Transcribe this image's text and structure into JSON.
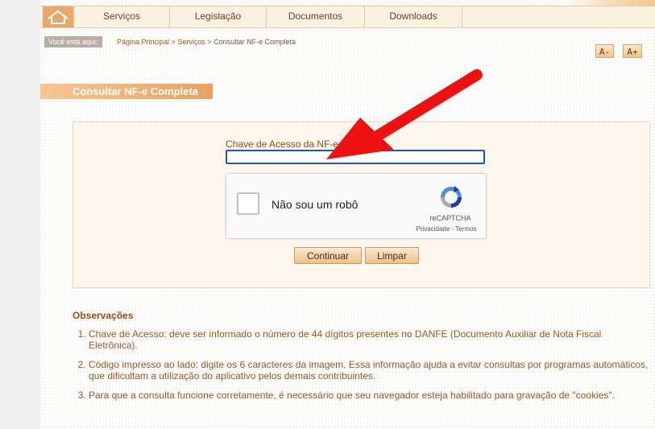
{
  "nav": {
    "items": [
      {
        "label": "Serviços"
      },
      {
        "label": "Legislação"
      },
      {
        "label": "Documentos"
      },
      {
        "label": "Downloads"
      }
    ]
  },
  "breadcrumb": {
    "prefix": "Você está aqui:",
    "home": "Página Principal",
    "sep1": " > ",
    "services": "Serviços",
    "sep2": " > ",
    "current": "Consultar NF-e Completa"
  },
  "font_controls": {
    "decrease": "A-",
    "increase": "A+"
  },
  "section_title": "Consultar NF-e Completa",
  "form": {
    "access_key_label": "Chave de Acesso da NF-e",
    "access_key_value": ""
  },
  "recaptcha": {
    "label": "Não sou um robô",
    "brand": "reCAPTCHA",
    "links": "Privacidade - Termos"
  },
  "buttons": {
    "continue": "Continuar",
    "clear": "Limpar"
  },
  "observations": {
    "title": "Observações",
    "items": [
      "Chave de Acesso: deve ser informado o número de 44 dígitos presentes no DANFE (Documento Auxiliar de Nota Fiscal Eletrônica).",
      "Código impresso ao lado: digite os 6 caracteres da imagem. Essa informação ajuda a evitar consultas por programas automáticos, que dificultam a utilização do aplicativo pelos demais contribuintes.",
      "Para que a consulta funcione corretamente, é necessário que seu navegador esteja habilitado para gravação de \"cookies\"."
    ]
  },
  "colors": {
    "accent": "#e9a86a",
    "text_brown": "#9a4b14",
    "annotation_arrow": "#ee1111"
  },
  "icons": {
    "home": "house-icon",
    "recaptcha": "recaptcha-logo-icon"
  }
}
